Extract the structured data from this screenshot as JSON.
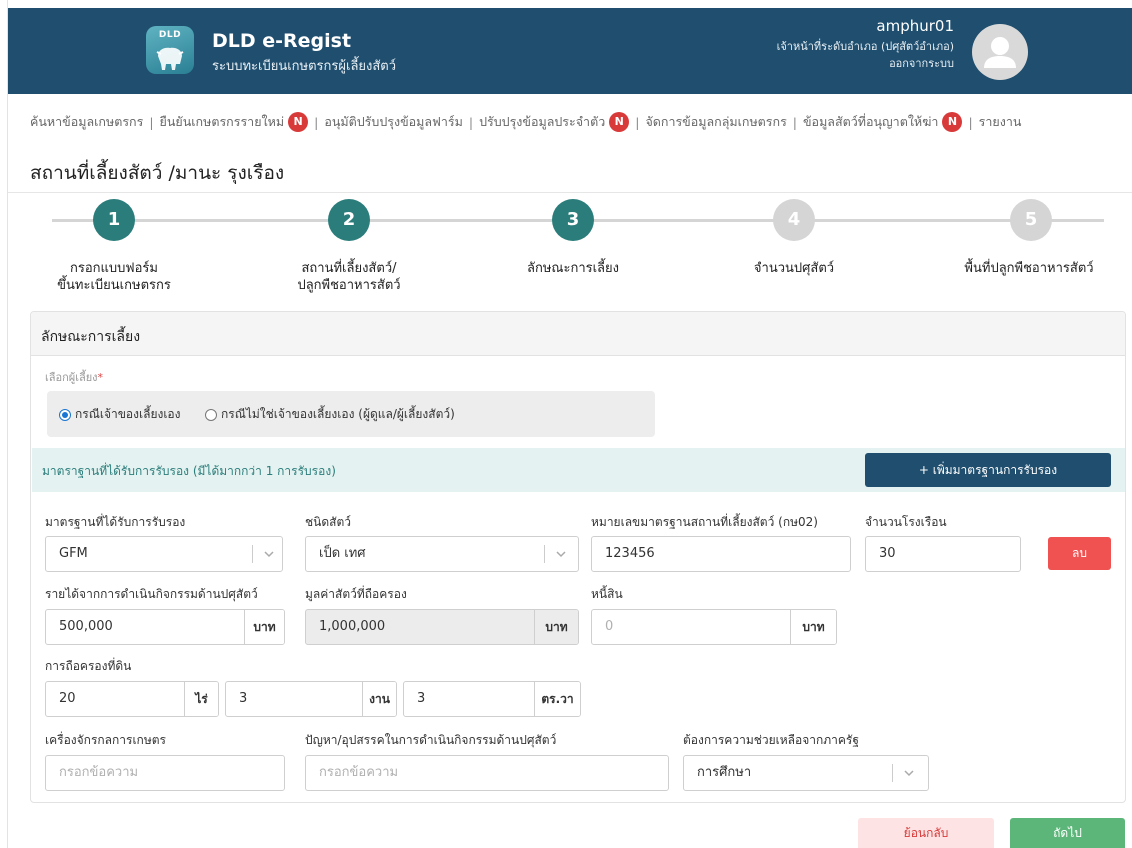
{
  "header": {
    "logo_text": "DLD",
    "app_title": "DLD e-Regist",
    "app_subtitle": "ระบบทะเบียนเกษตรกรผู้เลี้ยงสัตว์",
    "user_name": "amphur01",
    "user_role": "เจ้าหน้าที่ระดับอำเภอ (ปศุสัตว์อำเภอ)",
    "logout_label": "ออกจากระบบ"
  },
  "nav": {
    "items": [
      {
        "label": "ค้นหาข้อมูลเกษตรกร",
        "badge": ""
      },
      {
        "label": "ยืนยันเกษตรกรรายใหม่",
        "badge": "N"
      },
      {
        "label": "อนุมัติปรับปรุงข้อมูลฟาร์ม",
        "badge": ""
      },
      {
        "label": "ปรับปรุงข้อมูลประจำตัว",
        "badge": "N"
      },
      {
        "label": "จัดการข้อมูลกลุ่มเกษตรกร",
        "badge": ""
      },
      {
        "label": "ข้อมูลสัตว์ที่อนุญาตให้ฆ่า",
        "badge": "N"
      },
      {
        "label": "รายงาน",
        "badge": ""
      }
    ],
    "separator": "|"
  },
  "page_title": "สถานที่เลี้ยงสัตว์ /มานะ รุงเรือง",
  "stepper": {
    "steps": [
      {
        "number": "1",
        "label_line1": "กรอกแบบฟอร์ม",
        "label_line2": "ขึ้นทะเบียนเกษตรกร",
        "state": "complete"
      },
      {
        "number": "2",
        "label_line1": "สถานที่เลี้ยงสัตว์/",
        "label_line2": "ปลูกพืชอาหารสัตว์",
        "state": "complete"
      },
      {
        "number": "3",
        "label_line1": "ลักษณะการเลี้ยง",
        "label_line2": "",
        "state": "current"
      },
      {
        "number": "4",
        "label_line1": "จำนวนปศุสัตว์",
        "label_line2": "",
        "state": "pending"
      },
      {
        "number": "5",
        "label_line1": "พื้นที่ปลูกพืชอาหารสัตว์",
        "label_line2": "",
        "state": "pending"
      }
    ],
    "active_color": "#2b7d7b",
    "inactive_color": "#d5d5d5"
  },
  "form": {
    "card_title": "ลักษณะการเลี้ยง",
    "raiser_label": "เลือกผู้เลี้ยง",
    "required_mark": "*",
    "raiser_options": [
      {
        "label": "กรณีเจ้าของเลี้ยงเอง",
        "checked": true
      },
      {
        "label": "กรณีไม่ใช่เจ้าของเลี้ยงเอง (ผู้ดูแล/ผู้เลี้ยงสัตว์)",
        "checked": false
      }
    ],
    "standard_bar_text": "มาตราฐานที่ได้รับการรับรอง (มีได้มากกว่า 1 การรับรอง)",
    "add_standard_button": "+ เพิ่มมาตรฐานการรับรอง",
    "standard_label": "มาตรฐานที่ได้รับการรับรอง",
    "standard_value": "GFM",
    "animal_type_label": "ชนิดสัตว์",
    "animal_type_value": "เป็ด เทศ",
    "standard_number_label": "หมายเลขมาตรฐานสถานที่เลี้ยงสัตว์ (กษ02)",
    "standard_number_value": "123456",
    "barn_count_label": "จำนวนโรงเรือน",
    "barn_count_value": "30",
    "delete_button": "ลบ",
    "income_label": "รายได้จากการดำเนินกิจกรรมด้านปศุสัตว์",
    "income_value": "500,000",
    "animal_value_label": "มูลค่าสัตว์ที่ถือครอง",
    "animal_value_value": "1,000,000",
    "debt_label": "หนี้สิน",
    "debt_placeholder": "0",
    "currency_unit": "บาท",
    "land_label": "การถือครองที่ดิน",
    "land_rai_value": "20",
    "land_rai_unit": "ไร่",
    "land_ngan_value": "3",
    "land_ngan_unit": "งาน",
    "land_wa_value": "3",
    "land_wa_unit": "ตร.วา",
    "machinery_label": "เครื่องจักรกลการเกษตร",
    "machinery_placeholder": "กรอกข้อความ",
    "problems_label": "ปัญหา/อุปสรรคในการดำเนินกิจกรรมด้านปศุสัตว์",
    "problems_placeholder": "กรอกข้อความ",
    "assistance_label": "ต้องการความช่วยเหลือจากภาครัฐ",
    "assistance_value": "การศึกษา"
  },
  "footer": {
    "back_button": "ย้อนกลับ",
    "next_button": "ถัดไป"
  }
}
